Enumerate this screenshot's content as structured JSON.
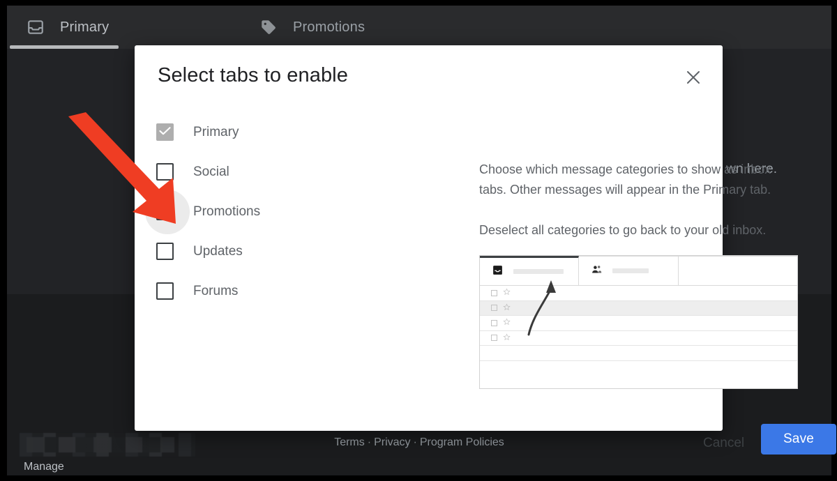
{
  "colors": {
    "accent_blue": "#3b78e7",
    "annotation_red": "#ef3d23",
    "app_dark_bg": "#202124",
    "tabstrip_bg": "#2a2b2d",
    "dialog_bg": "#ffffff",
    "text_secondary": "#5f6368"
  },
  "app": {
    "tabs": [
      {
        "label": "Primary",
        "icon": "inbox-icon",
        "active": true
      },
      {
        "label": "Promotions",
        "icon": "tag-icon",
        "active": false
      }
    ],
    "inbox_hint": "wn here.",
    "manage_label": "Manage",
    "footer": {
      "links": [
        "Terms",
        "Privacy",
        "Program Policies"
      ],
      "separator": "·"
    }
  },
  "dialog": {
    "title": "Select tabs to enable",
    "close_icon": "close-icon",
    "categories": [
      {
        "label": "Primary",
        "checked": true,
        "disabled": true,
        "hovered": false
      },
      {
        "label": "Social",
        "checked": false,
        "disabled": false,
        "hovered": false
      },
      {
        "label": "Promotions",
        "checked": false,
        "disabled": false,
        "hovered": true
      },
      {
        "label": "Updates",
        "checked": false,
        "disabled": false,
        "hovered": false
      },
      {
        "label": "Forums",
        "checked": false,
        "disabled": false,
        "hovered": false
      }
    ],
    "description": {
      "paragraph_1": "Choose which message categories to show as inbox tabs. Other messages will appear in the Primary tab.",
      "paragraph_2": "Deselect all categories to go back to your old inbox."
    },
    "preview": {
      "tab_1_icon": "inbox-icon",
      "tab_2_icon": "people-icon",
      "arrow_icon": "curved-arrow-icon"
    },
    "buttons": {
      "cancel": "Cancel",
      "save": "Save"
    }
  }
}
